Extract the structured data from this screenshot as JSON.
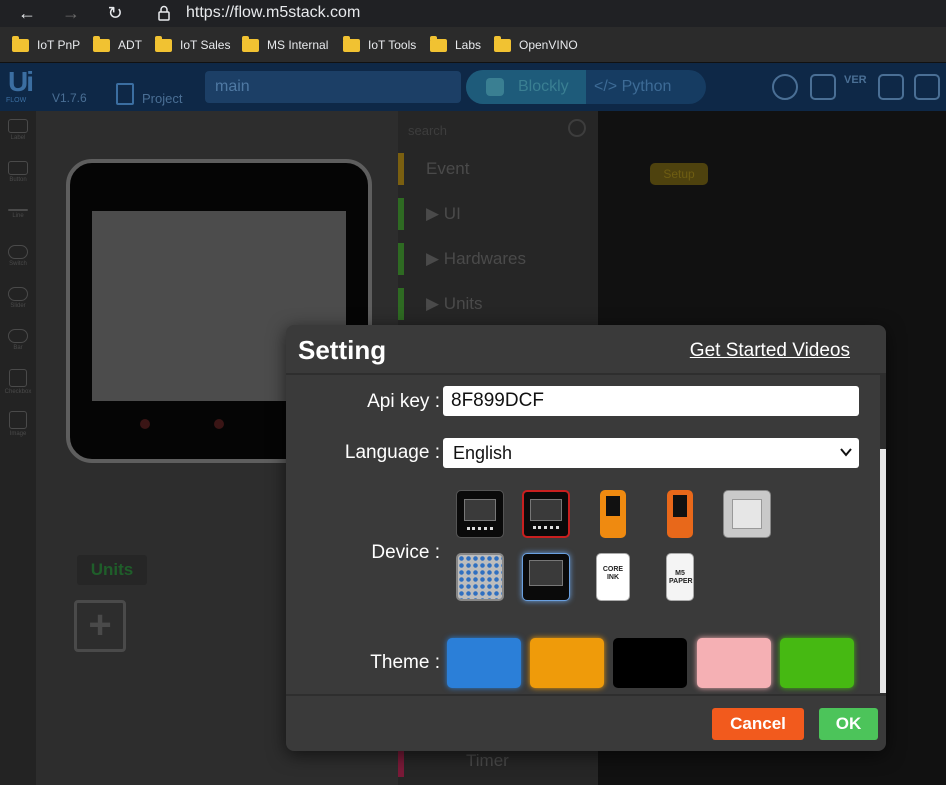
{
  "browser": {
    "url": "https://flow.m5stack.com",
    "bookmarks": [
      "IoT PnP",
      "ADT",
      "IoT Sales",
      "MS Internal",
      "IoT Tools",
      "Labs",
      "OpenVINO"
    ]
  },
  "app": {
    "logo": "Ui",
    "logo_sub": "FLOW",
    "version": "V1.7.6",
    "project_label": "Project",
    "project_name": "main",
    "tabs": {
      "blockly": "Blockly",
      "python": "</> Python"
    },
    "header_icons": [
      "m5-logo-icon",
      "new-file-icon",
      "version-icon",
      "chat-icon",
      "save-icon"
    ],
    "header_ver_label": "VER",
    "rail_items": [
      "Label",
      "Button",
      "Line",
      "Switch",
      "Slider",
      "Bar",
      "Checkbox",
      "Image"
    ],
    "palette": {
      "search_placeholder": "search",
      "items": [
        {
          "label": "Event",
          "color": "#7a5f10"
        },
        {
          "label": "▶ UI",
          "color": "#2e6a22"
        },
        {
          "label": "▶ Hardwares",
          "color": "#2e6a22"
        },
        {
          "label": "▶ Units",
          "color": "#2e6a22"
        },
        {
          "label": "Timer",
          "color": "#7a1a38"
        }
      ]
    },
    "units_label": "Units",
    "workspace_block": "Setup"
  },
  "dialog": {
    "title": "Setting",
    "link": "Get Started Videos",
    "api_key_label": "Api key :",
    "api_key_value": "8F899DCF",
    "language_label": "Language :",
    "language_value": "English",
    "device_label": "Device :",
    "devices": [
      {
        "name": "M5Stack Basic"
      },
      {
        "name": "M5Stack Fire"
      },
      {
        "name": "M5StickC"
      },
      {
        "name": "M5StickC Plus"
      },
      {
        "name": "M5Atom"
      },
      {
        "name": "M5Atom Matrix"
      },
      {
        "name": "M5Stack Core2"
      },
      {
        "name": "M5 CoreInk"
      },
      {
        "name": "M5Paper"
      }
    ],
    "coreink_text": "CORE INK",
    "paper_text": "M5 PAPER",
    "theme_label": "Theme :",
    "themes": [
      "#2b7fd8",
      "#ef9b0a",
      "#000000",
      "#f5b0b4",
      "#46b912"
    ],
    "cancel_label": "Cancel",
    "ok_label": "OK"
  }
}
